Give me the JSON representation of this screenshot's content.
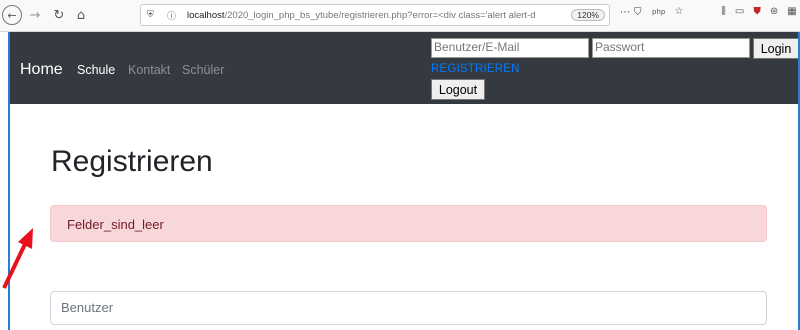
{
  "browser": {
    "url_host": "localhost",
    "url_path": "/2020_login_php_bs_ytube/registrieren.php?error=<div class='alert alert-d",
    "zoom": "120%",
    "menu_glyph": "⋯",
    "pocket_glyph": "⛉",
    "php_tag": "php",
    "star_glyph": "☆",
    "back_glyph": "←",
    "forward_glyph": "→",
    "reload_glyph": "↻",
    "home_glyph": "⌂"
  },
  "navbar": {
    "brand": "Home",
    "links": [
      "Schule",
      "Kontakt",
      "Schüler"
    ],
    "user_placeholder": "Benutzer/E-Mail",
    "pass_placeholder": "Passwort",
    "login_label": "Login",
    "register_label": "REGISTRIEREN",
    "logout_label": "Logout"
  },
  "page": {
    "title": "Registrieren",
    "alert_text": "Felder_sind_leer",
    "user_field_placeholder": "Benutzer"
  },
  "colors": {
    "navbar_bg": "#343a40",
    "alert_bg": "#f8d7da",
    "alert_text": "#721c24",
    "link_blue": "#007bff",
    "arrow_red": "#e8121c"
  }
}
